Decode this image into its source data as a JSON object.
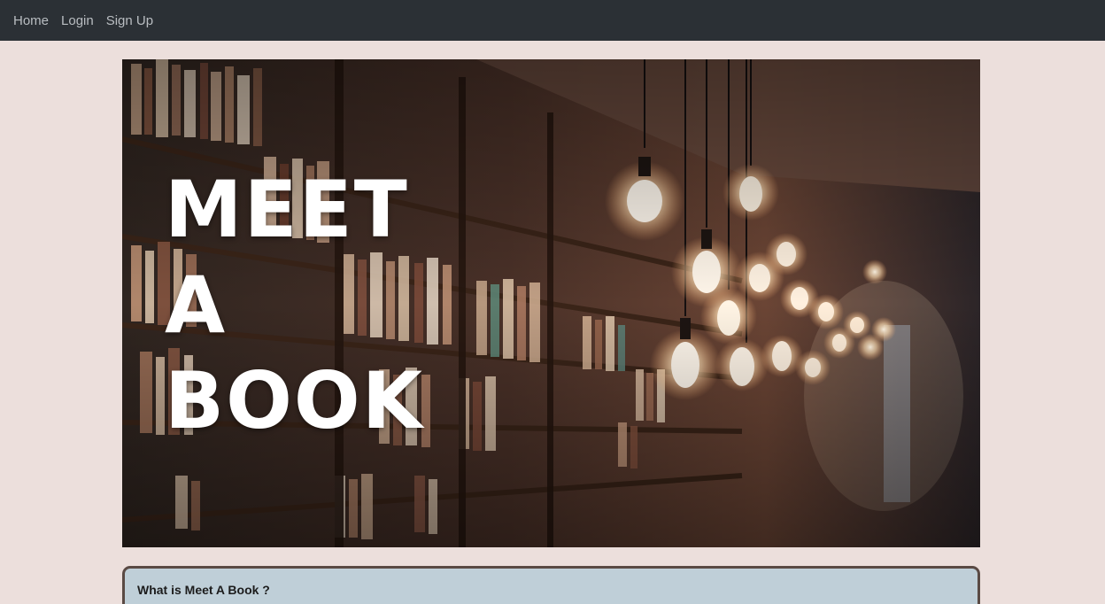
{
  "navbar": {
    "links": [
      "Home",
      "Login",
      "Sign Up"
    ]
  },
  "hero": {
    "title_lines": [
      "MEET",
      "A",
      "BOOK"
    ]
  },
  "info": {
    "title": "What is Meet A Book ?"
  },
  "colors": {
    "page_bg": "#ecdfdc",
    "navbar_bg": "#2b3035",
    "nav_link": "#b9bdc1",
    "card_bg": "#bfcfd8",
    "card_border": "#5a4a44"
  }
}
